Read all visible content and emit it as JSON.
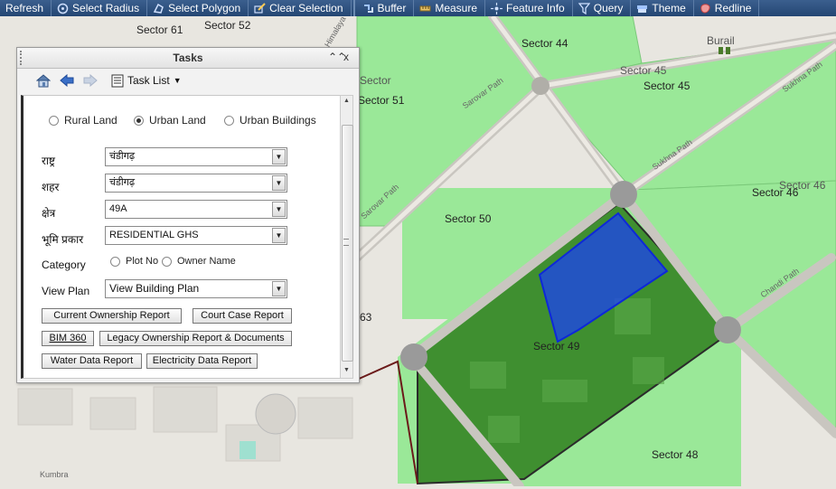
{
  "toolbar": {
    "items": [
      {
        "label": "Refresh",
        "icon": "refresh-icon"
      },
      {
        "label": "Select Radius",
        "icon": "select-radius-icon"
      },
      {
        "label": "Select Polygon",
        "icon": "select-polygon-icon"
      },
      {
        "label": "Clear Selection",
        "icon": "clear-selection-icon"
      },
      {
        "label": "Buffer",
        "icon": "buffer-icon"
      },
      {
        "label": "Measure",
        "icon": "measure-icon"
      },
      {
        "label": "Feature Info",
        "icon": "feature-info-icon"
      },
      {
        "label": "Query",
        "icon": "query-icon"
      },
      {
        "label": "Theme",
        "icon": "theme-icon"
      },
      {
        "label": "Redline",
        "icon": "redline-icon"
      }
    ]
  },
  "map": {
    "labels": {
      "sector61": "Sector 61",
      "sector52": "Sector 52",
      "sector44": "Sector 44",
      "burail": "Burail",
      "sector45a": "Sector 45",
      "sector45b": "Sector 45",
      "sector_faded": "Sector",
      "sector51": "Sector 51",
      "sarovar_path1": "Sarovar Path",
      "sarovar_path2": "Sarovar Path",
      "sukhna_path1": "Sukhna Path",
      "sukhna_path2": "Sukhna Path",
      "sector46a": "Sector 46",
      "sector46b": "Sector 46",
      "sector50": "Sector 50",
      "sector49": "Sector 49",
      "sector63": "63",
      "chandi_path": "Chandi Path",
      "sector48": "Sector 48",
      "kumbra": "Kumbra",
      "himalaya": "Himalaya"
    },
    "colors": {
      "background": "#e8e6e0",
      "sector_fill": "#9ae898",
      "sector_dark": "#3f8f30",
      "selection": "#1a3cff",
      "road": "#c9c6c0"
    }
  },
  "tasks": {
    "title": "Tasks",
    "collapse": "⌃⌃",
    "close": "x",
    "task_list_label": "Task List",
    "land_types": [
      {
        "label": "Rural Land",
        "selected": false
      },
      {
        "label": "Urban Land",
        "selected": true
      },
      {
        "label": "Urban Buildings",
        "selected": false
      }
    ],
    "fields": [
      {
        "label": "राष्ट्र",
        "value": "चंडीगढ़"
      },
      {
        "label": "शहर",
        "value": "चंडीगढ़"
      },
      {
        "label": "क्षेत्र",
        "value": "49A"
      },
      {
        "label": "भूमि प्रकार",
        "value": "RESIDENTIAL GHS"
      }
    ],
    "category": {
      "label": "Category",
      "options": [
        {
          "label": "Plot No",
          "selected": false
        },
        {
          "label": "Owner Name",
          "selected": false
        }
      ]
    },
    "view_plan": {
      "label": "View Plan",
      "value": "View Building Plan"
    },
    "buttons": {
      "current_ownership": "Current Ownership Report",
      "court_case": "Court Case Report",
      "bim360": "BIM 360",
      "legacy": "Legacy Ownership Report & Documents",
      "water": "Water Data Report",
      "electricity": "Electricity Data Report"
    }
  }
}
